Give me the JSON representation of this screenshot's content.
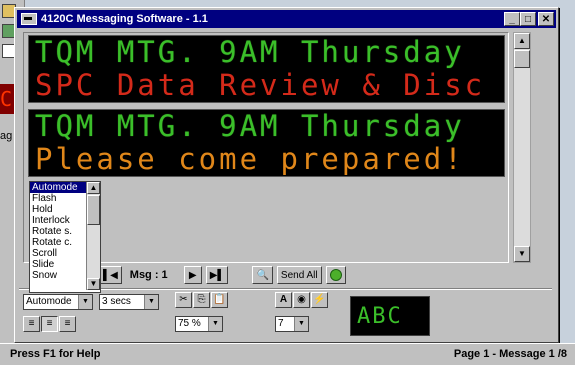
{
  "window": {
    "title": "4120C  Messaging Software - 1.1"
  },
  "desktop": {
    "big_char": "C",
    "label": "ag"
  },
  "display": {
    "panel1": {
      "line1": "TQM MTG. 9AM Thursday",
      "line2": "SPC Data Review & Disc"
    },
    "panel2": {
      "line1": "TQM MTG. 9AM Thursday",
      "line2": "Please come prepared!"
    }
  },
  "mode_list": [
    "Automode",
    "Flash",
    "Hold",
    "Interlock",
    "Rotate s.",
    "Rotate c.",
    "Scroll",
    "Slide",
    "Snow"
  ],
  "nav": {
    "msg_label": "Msg : 1",
    "send_all": "Send All"
  },
  "toolbar": {
    "mode_select": "Automode",
    "time_select": "3 secs",
    "zoom_select": "75 %",
    "size_select": "7"
  },
  "preview": {
    "text": "ABC"
  },
  "status": {
    "help": "Press F1 for Help",
    "page": "Page 1  - Message 1  /8"
  },
  "colors": {
    "led_green": "#3bbf2a",
    "led_red": "#d42a1a",
    "led_orange": "#e0871a",
    "title_bar": "#000080"
  }
}
